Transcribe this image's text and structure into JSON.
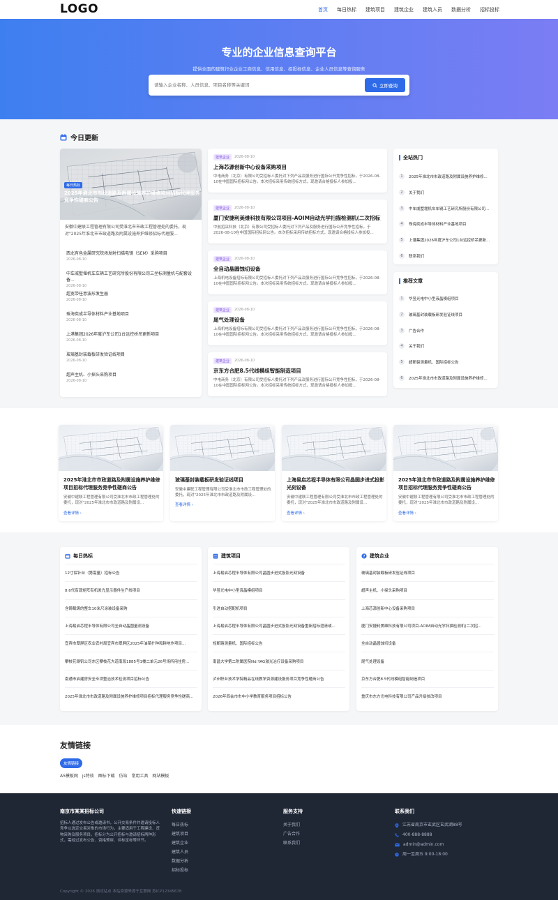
{
  "header": {
    "logo": "LOGO",
    "nav": [
      "首页",
      "每日热标",
      "建筑项目",
      "建筑企业",
      "建筑人员",
      "数据分析",
      "招标投标"
    ]
  },
  "hero": {
    "title": "专业的企业信息查询平台",
    "subtitle": "提供全面的建筑行业企业工商信息、信用信息、招投标信息、企业人员信息等查询服务",
    "search_placeholder": "请输入企业名称、人员信息、项目名称等关键词",
    "search_button": "立即查询"
  },
  "today": {
    "title": "今日更新",
    "featured": {
      "badge": "每日热标",
      "image_title": "2025年淮北市市政道路及附属设施养护维修项目招标代理服务竞争性磋商公告",
      "desc": "安徽中建联工程管理有限公司受淮北市市政工程管理处的委托，现对\"2025年淮北市市政道路及附属设施养护维修招标代理服..."
    },
    "list": [
      {
        "title": "西北有色金属研究院场发射扫描电镜（SEM）采购项目",
        "date": "2026-08-10"
      },
      {
        "title": "中车戚墅堰机车车辆工艺研究所股份有限公司三坐标测量机与配套设备...",
        "date": "2026-08-10"
      },
      {
        "title": "超宽带任意波形发生器",
        "date": "2026-08-10"
      },
      {
        "title": "珠海奕成半导体材料产业基地项目",
        "date": "2026-08-10"
      },
      {
        "title": "上港集团2026年度沪东公司1台远控桥吊更新项目",
        "date": "2026-08-10"
      },
      {
        "title": "玻璃基封装载板研发验证线项目",
        "date": "2026-08-10"
      },
      {
        "title": "超声主机、小探头采购项目",
        "date": "2026-08-10"
      }
    ],
    "news": [
      {
        "tag": "建筑企业",
        "date": "2026-08-10",
        "title": "上海芯源创新中心设备采购项目",
        "desc": "中电商务（北京）有限公司受招标人委托对下列产品及服务进行国际公开竞争性招标，于2026-08-10在中国国际招标网公告。本次招标采用传统招标方式，现邀请合格投标人参加投..."
      },
      {
        "tag": "建筑企业",
        "date": "2026-08-10",
        "title": "厦门安捷利美维科技有限公司项目-AOIM自动光学扫描检测机(二次招标)",
        "desc": "中航招采科技（北京）有限公司受招标人委托对下列产品及服务进行国际公开竞争性招标，于2026-08-10在中国国际招标网公告。本次招标采用传统招标方式，现邀请合格投标人参加投..."
      },
      {
        "tag": "建筑企业",
        "date": "2026-08-10",
        "title": "全自动晶圆蚀切设备",
        "desc": "上海机电设备招标有限公司受招标人委托对下列产品及服务进行国际公开竞争性招标，于2026-08-10在中国国际招标网公告。本次招标采用传统招标方式，现邀请合格投标人参加投..."
      },
      {
        "tag": "建筑企业",
        "date": "2026-08-10",
        "title": "尾气处理设备",
        "desc": "上海机电设备招标有限公司受招标人委托对下列产品及服务进行国际公开竞争性招标，于2026-08-10在中国国际招标网公告。本次招标采用传统招标方式，现邀请合格投标人参加投..."
      },
      {
        "tag": "建筑企业",
        "date": "2026-08-10",
        "title": "京东方合肥8.5代线模组智能制造项目",
        "desc": "中电商务（北京）有限公司受招标人委托对下列产品及服务进行国际公开竞争性招标，于2026-08-10在中国国际招标网公告。本次招标采用传统招标方式，现邀请合格投标人参加投..."
      }
    ],
    "hot": {
      "title": "全站热门",
      "items": [
        "2025年淮北市市政道路及附属设施养护维修...",
        "关于我们",
        "中车戚墅堰机车车辆工艺研究所股份有限公司...",
        "珠海奕成半导体材料产业基地项目",
        "上港集团2026年度沪东公司1台远控桥吊更新...",
        "联系我们"
      ]
    },
    "recommend": {
      "title": "推荐文章",
      "items": [
        "华昱光电中小型液晶模组项目",
        "玻璃基封装载板研发验证线项目",
        "广告合作",
        "关于我们",
        "超断裂测量机、国际招标公告",
        "2025年淮北市市政道路及附属设施养护维修..."
      ]
    }
  },
  "products": [
    {
      "title": "2025年淮北市市政道路及附属设施养护维修项目招标代理服务竞争性磋商公告",
      "desc": "安徽中建联工程管理有限公司受淮北市市政工程管理处的委托，现对\"2025年淮北市市政道路及附属设...",
      "more": "查看详情 ›"
    },
    {
      "title": "玻璃基封装载板研发验证线项目",
      "desc": "安徽中建联工程管理有限公司受淮北市市政工程管理处的委托，现对\"2025年淮北市市政道路及附属设...",
      "more": "查看详情 ›"
    },
    {
      "title": "上海易启芯程半导体有限公司晶圆步进式投影光刻设备",
      "desc": "安徽中建联工程管理有限公司受淮北市市政工程管理处的委托，现对\"2025年淮北市市政道路及附属设...",
      "more": "查看详情 ›"
    },
    {
      "title": "2025年淮北市市政道路及附属设施养护维修项目招标代理服务竞争性磋商公告",
      "desc": "安徽中建联工程管理有限公司受淮北市市政工程管理处的委托，现对\"2025年淮北市市政道路及附属设...",
      "more": "查看详情 ›"
    }
  ],
  "lists": [
    {
      "title": "每日热标",
      "items": [
        "12寸探针台（第需量）招标公告",
        "8.6代有源矩阵有机发光显示器件生产线项目",
        "含铸载铸的整车10米尺涂装设备采购",
        "上海易启芯程半导体有限公司全自动晶圆量测设备",
        "宜宾市翠屏区农业农村局宜宾市翠屏区2025年油菜扩种和耕地作项目...",
        "攀枝花钢钒公司东区攀枝花大道南段1885号1楼二单元26号场所用住房...",
        "南通市启建房安全专项整治技术检测项目招标公告",
        "2025年淮北市市政道路及附属设施养护维修项目招标代理服务竞争性磋商..."
      ]
    },
    {
      "title": "建筑项目",
      "items": [
        "上海易启芯程半导体有限公司晶圆步进式投影光刻设备",
        "华昱光电中小型液晶模组项目",
        "引进自动搭配机项目",
        "上海易启芯程半导体有限公司晶圆步进式投影光刻设备重新招标澄清或...",
        "短断路测量机、国际招标公告",
        "南昌大学第二附属医院Nd:YAG激光治疗设备采购项目",
        "泸州职业技术学院精品在线教学资源建设服务项目竞争性磋商公告",
        "2026年四会市市中小学教育服务项目招标公告"
      ]
    },
    {
      "title": "建筑企业",
      "items": [
        "玻璃基封装载板研发验证线项目",
        "超声主机、小探头采购项目",
        "上海芯源创新中心设备采购项目",
        "厦门安捷利美维科技有限公司项目-AOIM自动光学扫描检测机(二次招...",
        "全自动晶圆蚀切设备",
        "尾气处理设备",
        "京东方合肥8.5代线模组智能制造项目",
        "重庆市东方光电科技有限公司产品升级技改项目"
      ]
    }
  ],
  "friends": {
    "title": "友情链接",
    "tab": "友情链接",
    "links": [
      "A5模板网",
      "js特效",
      "图标下载",
      "仿站",
      "常用工具",
      "网站模板"
    ]
  },
  "footer": {
    "company": "南京市某某招标公司",
    "about": "招标人通过发布公告或邀请书，公开交易条件并邀请投标人竞争以选定交易对象的市场行为，主要适用于工程建设、货物采购及服务项目。招标分为公开招标与邀请招标两种形式，需经过发布公告、资格预审、评标定标等环节。",
    "quick": {
      "title": "快速链接",
      "items": [
        "每日热标",
        "建筑项目",
        "建筑企业",
        "建筑人员",
        "数据分析",
        "招标投标"
      ]
    },
    "service": {
      "title": "服务支持",
      "items": [
        "关于我们",
        "广告合作",
        "联系我们"
      ]
    },
    "contact": {
      "title": "联系我们",
      "address": "江苏省南京市玄武区玄武湖88号",
      "phone": "400-888-8888",
      "email": "admin@admin.com",
      "hours": "周一至周五 9:00-18:00"
    },
    "copyright": "Copyright © 2026 测试站点 本站资源来源于互联网 苏ICP12345678"
  }
}
